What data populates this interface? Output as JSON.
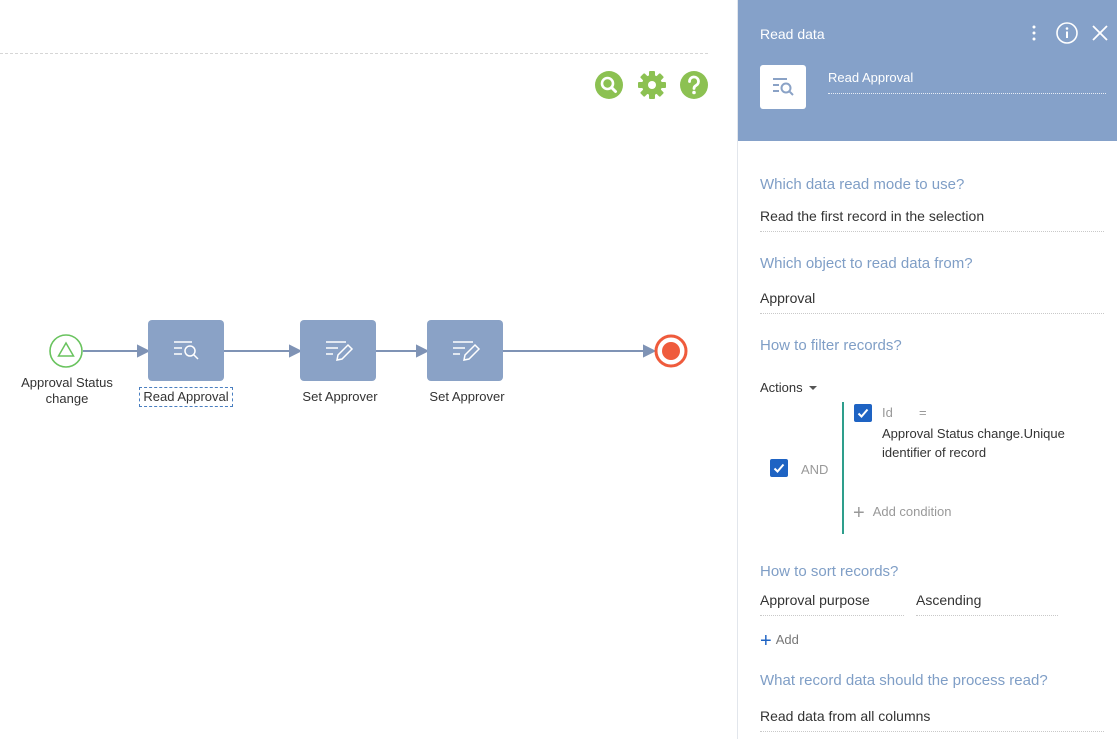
{
  "canvas": {
    "toolbar": {
      "search_icon": "search-icon",
      "settings_icon": "gear-icon",
      "help_icon": "help-icon",
      "accent_color": "#8cc152"
    },
    "nodes": {
      "start_label": "Approval Status change",
      "read_label": "Read Approval",
      "set1_label": "Set Approver",
      "set2_label": "Set Approver"
    },
    "colors": {
      "task_fill": "#8aa2c6",
      "start_stroke": "#69c35e",
      "end_stroke": "#ef5b3c"
    }
  },
  "panel": {
    "title": "Read data",
    "element_name": "Read Approval",
    "header_color": "#85a1c9",
    "read_mode": {
      "title": "Which data read mode to use?",
      "value": "Read the first record in the selection"
    },
    "object": {
      "title": "Which object to read data from?",
      "value": "Approval"
    },
    "filter": {
      "title": "How to filter records?",
      "actions_label": "Actions",
      "group_operator": "AND",
      "condition": {
        "column": "Id",
        "operator": "=",
        "value": "Approval Status change.Unique identifier of record"
      },
      "add_condition": "Add condition"
    },
    "sort": {
      "title": "How to sort records?",
      "column": "Approval purpose",
      "direction": "Ascending",
      "add_label": "Add"
    },
    "columns": {
      "title": "What record data should the process read?",
      "value": "Read data from all columns"
    }
  }
}
